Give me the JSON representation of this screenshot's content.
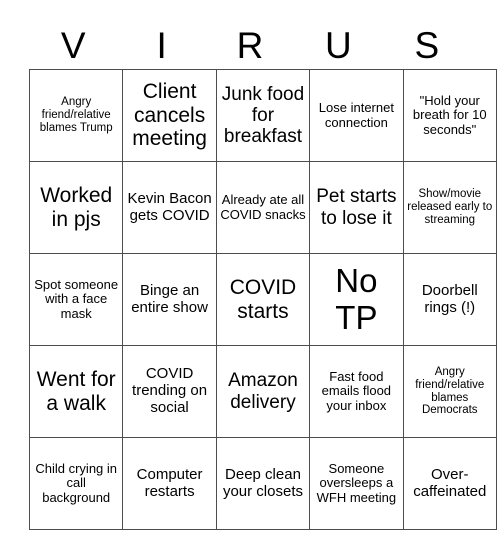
{
  "card": {
    "title_letters": [
      "V",
      "I",
      "R",
      "U",
      "S"
    ],
    "rows": [
      [
        {
          "text": "Angry friend/relative blames Trump",
          "size": "sz-xs"
        },
        {
          "text": "Client cancels meeting",
          "size": "sz-xl"
        },
        {
          "text": "Junk food for breakfast",
          "size": "sz-l"
        },
        {
          "text": "Lose internet connection",
          "size": "sz-s"
        },
        {
          "text": "\"Hold your breath for 10 seconds\"",
          "size": "sz-s"
        }
      ],
      [
        {
          "text": "Worked in pjs",
          "size": "sz-xl"
        },
        {
          "text": "Kevin Bacon gets COVID",
          "size": "sz-m"
        },
        {
          "text": "Already ate all COVID snacks",
          "size": "sz-s"
        },
        {
          "text": "Pet starts to lose it",
          "size": "sz-l"
        },
        {
          "text": "Show/movie released early to streaming",
          "size": "sz-xs"
        }
      ],
      [
        {
          "text": "Spot someone with a face mask",
          "size": "sz-s"
        },
        {
          "text": "Binge an entire show",
          "size": "sz-m"
        },
        {
          "text": "COVID starts",
          "size": "sz-xl"
        },
        {
          "text": "No TP",
          "size": "sz-xxl"
        },
        {
          "text": "Doorbell rings (!)",
          "size": "sz-m"
        }
      ],
      [
        {
          "text": "Went for a walk",
          "size": "sz-xl"
        },
        {
          "text": "COVID trending on social",
          "size": "sz-m"
        },
        {
          "text": "Amazon delivery",
          "size": "sz-l"
        },
        {
          "text": "Fast food emails flood your inbox",
          "size": "sz-s"
        },
        {
          "text": "Angry friend/relative blames Democrats",
          "size": "sz-xs"
        }
      ],
      [
        {
          "text": "Child crying in call background",
          "size": "sz-s"
        },
        {
          "text": "Computer restarts",
          "size": "sz-m"
        },
        {
          "text": "Deep clean your closets",
          "size": "sz-m"
        },
        {
          "text": "Someone oversleeps a WFH meeting",
          "size": "sz-s"
        },
        {
          "text": "Over-caffeinated",
          "size": "sz-m"
        }
      ]
    ]
  },
  "colors": {
    "border": "#4d4d4d",
    "text": "#000000",
    "background": "#ffffff"
  }
}
